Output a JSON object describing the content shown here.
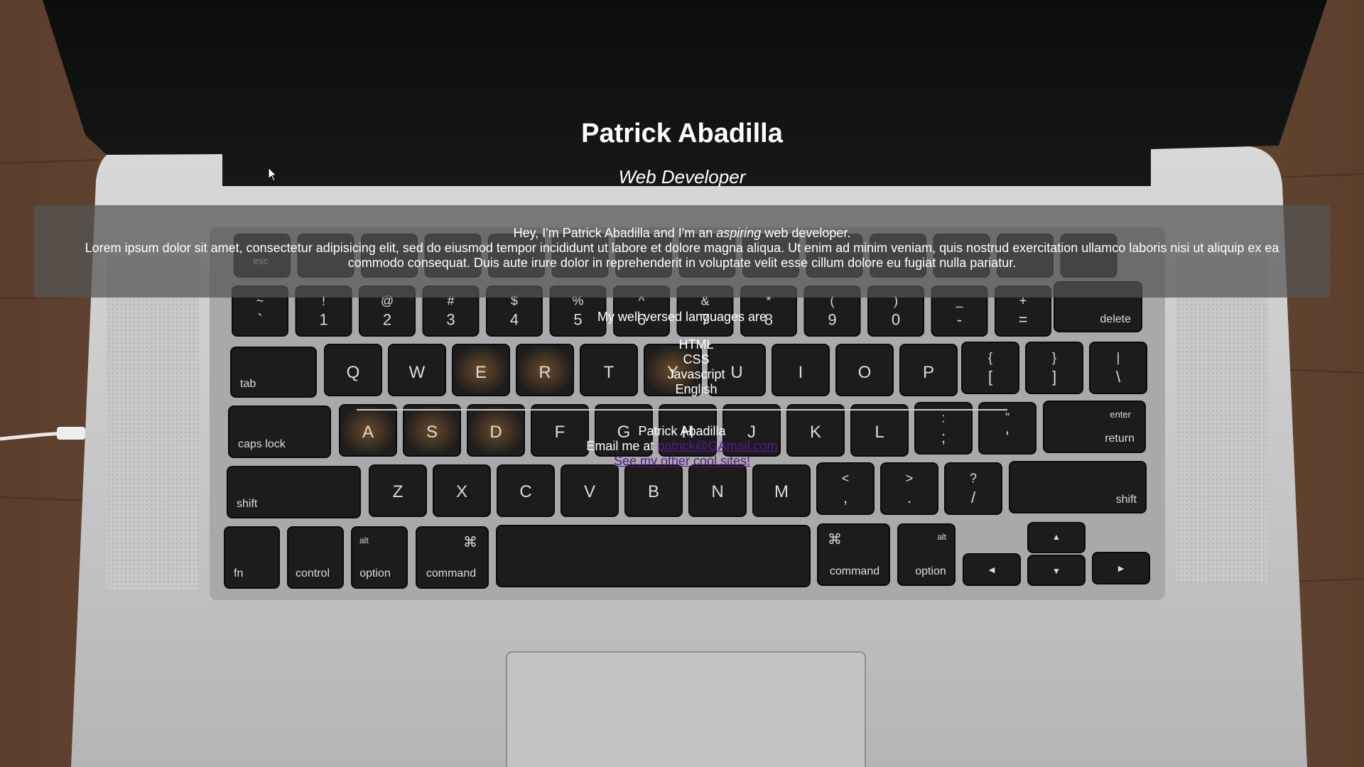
{
  "header": {
    "title": "Patrick Abadilla",
    "subtitle": "Web Developer"
  },
  "intro": {
    "lead_before": "Hey, I'm Patrick Abadilla and I'm an ",
    "lead_emphasis": "aspiring",
    "lead_after": " web developer.",
    "body": "Lorem ipsum dolor sit amet, consectetur adipisicing elit, sed do eiusmod tempor incididunt ut labore et dolore magna aliqua. Ut enim ad minim veniam, quis nostrud exercitation ullamco laboris nisi ut aliquip ex ea commodo consequat. Duis aute irure dolor in reprehenderit in voluptate velit esse cillum dolore eu fugiat nulla pariatur."
  },
  "languages": {
    "heading": "My well versed languages are",
    "items": [
      "HTML",
      "CSS",
      "Javascript",
      "English"
    ]
  },
  "footer": {
    "name": "Patrick Abadilla",
    "email_prefix": "Email me at ",
    "email_link": "patrick@GAmail.com",
    "sites_link": "See my other cool sites!"
  },
  "keyboard": {
    "row_number": [
      {
        "top": "~",
        "bottom": "`"
      },
      {
        "top": "!",
        "bottom": "1"
      },
      {
        "top": "@",
        "bottom": "2"
      },
      {
        "top": "#",
        "bottom": "3"
      },
      {
        "top": "$",
        "bottom": "4"
      },
      {
        "top": "%",
        "bottom": "5"
      },
      {
        "top": "^",
        "bottom": "6"
      },
      {
        "top": "&",
        "bottom": "7"
      },
      {
        "top": "*",
        "bottom": "8"
      },
      {
        "top": "(",
        "bottom": "9"
      },
      {
        "top": ")",
        "bottom": "0"
      },
      {
        "top": "_",
        "bottom": "-"
      },
      {
        "top": "+",
        "bottom": "="
      }
    ],
    "delete": "delete",
    "tab": "tab",
    "row_q": [
      "Q",
      "W",
      "E",
      "R",
      "T",
      "Y",
      "U",
      "I",
      "O",
      "P"
    ],
    "row_q_symbols": [
      {
        "top": "{",
        "bottom": "["
      },
      {
        "top": "}",
        "bottom": "]"
      },
      {
        "top": "|",
        "bottom": "\\"
      }
    ],
    "caps_lock": "caps lock",
    "row_a": [
      "A",
      "S",
      "D",
      "F",
      "G",
      "H",
      "J",
      "K",
      "L"
    ],
    "row_a_symbols": [
      {
        "top": ":",
        "bottom": ";"
      },
      {
        "top": "”",
        "bottom": "'"
      }
    ],
    "enter": "enter",
    "return": "return",
    "shift": "shift",
    "row_z": [
      "Z",
      "X",
      "C",
      "V",
      "B",
      "N",
      "M"
    ],
    "row_z_symbols": [
      {
        "top": "<",
        "bottom": ","
      },
      {
        "top": ">",
        "bottom": "."
      },
      {
        "top": "?",
        "bottom": "/"
      }
    ],
    "fn": "fn",
    "control": "control",
    "alt": "alt",
    "option": "option",
    "command": "command",
    "command_symbol": "⌘",
    "arrow_up": "▲",
    "arrow_down": "▼",
    "arrow_left": "◄",
    "arrow_right": "►",
    "esc": "esc"
  }
}
